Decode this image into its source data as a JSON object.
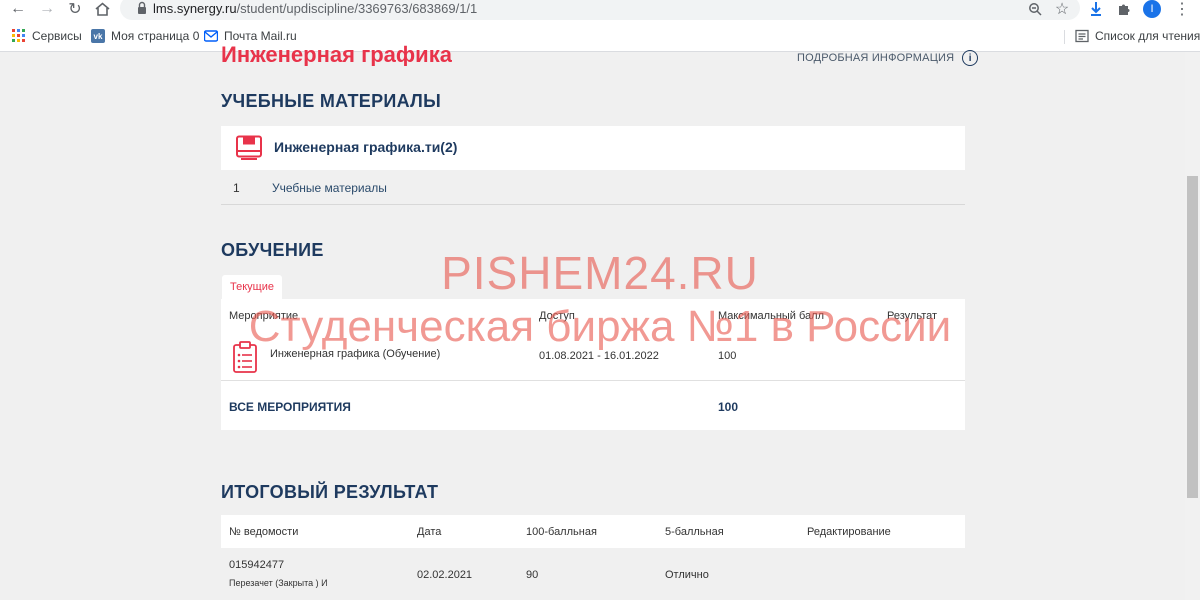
{
  "browser": {
    "url_host": "lms.synergy.ru",
    "url_path": "/student/updiscipline/3369763/683869/1/1",
    "profile_initial": "I",
    "bookmarks": [
      "Сервисы",
      "Моя страница 0",
      "Почта Mail.ru"
    ],
    "reading_list": "Список для чтения"
  },
  "page": {
    "title": "Инженерная графика",
    "more_info": "ПОДРОБНАЯ ИНФОРМАЦИЯ"
  },
  "materials": {
    "heading": "УЧЕБНЫЕ МАТЕРИАЛЫ",
    "item_title": "Инженерная графика.ти(2)",
    "sub_num": "1",
    "sub_link": "Учебные материалы"
  },
  "learning": {
    "heading": "ОБУЧЕНИЕ",
    "tab": "Текущие",
    "columns": [
      "Мероприятие",
      "Доступ",
      "Максимальный балл",
      "Результат"
    ],
    "row": {
      "event": "Инженерная графика (Обучение)",
      "access": "01.08.2021 - 16.01.2022",
      "max": "100",
      "result": ""
    },
    "total_label": "ВСЕ МЕРОПРИЯТИЯ",
    "total_max": "100"
  },
  "final": {
    "heading": "ИТОГОВЫЙ РЕЗУЛЬТАТ",
    "columns": [
      "№ ведомости",
      "Дата",
      "100-балльная",
      "5-балльная",
      "Редактирование"
    ],
    "row": {
      "number": "015942477",
      "note": "Перезачет (Закрыта ) И",
      "date": "02.02.2021",
      "score100": "90",
      "score5": "Отлично"
    }
  },
  "watermark": {
    "line1": "PISHEM24.RU",
    "line2": "Студенческая биржа №1 в России"
  }
}
